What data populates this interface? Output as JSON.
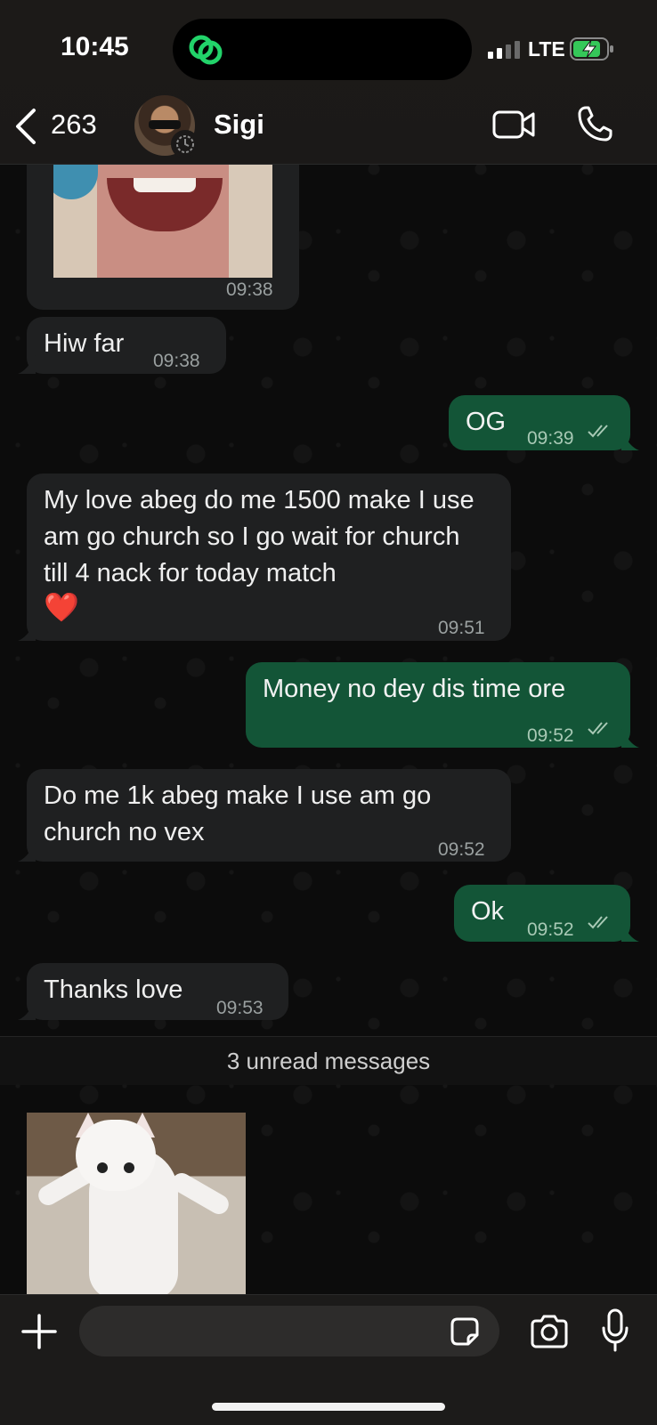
{
  "status_bar": {
    "time": "10:45",
    "network": "LTE",
    "battery_state": "charging",
    "island_icon": "link-rings-icon"
  },
  "header": {
    "back_count": "263",
    "contact_name": "Sigi",
    "video_icon": "video-camera-icon",
    "call_icon": "phone-icon"
  },
  "messages": [
    {
      "dir": "in",
      "type": "image",
      "time": "09:38"
    },
    {
      "dir": "in",
      "text": "Hiw far",
      "time": "09:38"
    },
    {
      "dir": "out",
      "text": "OG",
      "time": "09:39",
      "status": "read"
    },
    {
      "dir": "in",
      "text": "My love abeg do me 1500 make I use am go church so I go wait for church till 4 nack for today match",
      "emoji": "❤️",
      "time": "09:51"
    },
    {
      "dir": "out",
      "text": "Money no dey dis time ore",
      "time": "09:52",
      "status": "read"
    },
    {
      "dir": "in",
      "text": "Do me 1k abeg make I use am go church no vex",
      "time": "09:52"
    },
    {
      "dir": "out",
      "text": "Ok",
      "time": "09:52",
      "status": "read"
    },
    {
      "dir": "in",
      "text": "Thanks love",
      "time": "09:53"
    },
    {
      "dir": "in",
      "type": "image"
    }
  ],
  "unread_divider": "3 unread messages",
  "composer": {
    "placeholder": "",
    "icons": [
      "plus-icon",
      "sticker-icon",
      "camera-icon",
      "microphone-icon"
    ]
  },
  "colors": {
    "incoming_bubble": "#1f2021",
    "outgoing_bubble": "#135537",
    "background": "#0c0c0c",
    "accent_green": "#25d366"
  }
}
